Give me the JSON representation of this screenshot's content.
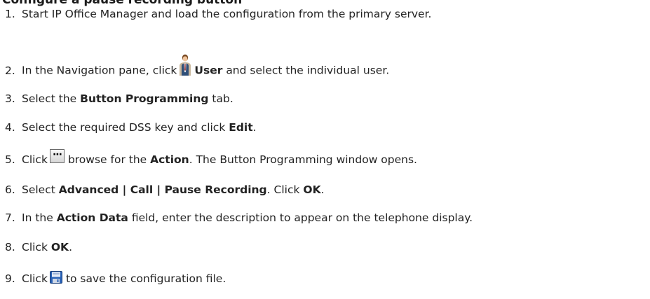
{
  "heading": "Configure a pause recording button",
  "steps": [
    {
      "num": "1.",
      "text": "Start IP Office Manager and load the configuration from the primary server."
    },
    {
      "num": "2.",
      "pre": "In the Navigation pane, click",
      "bold": "User",
      "post": "and select the individual user.",
      "icon": "user-icon"
    },
    {
      "num": "3.",
      "pre": "Select the",
      "bold": "Button Programming",
      "post": "tab."
    },
    {
      "num": "4.",
      "pre": "Select the required DSS key and click",
      "bold": "Edit",
      "post": "."
    },
    {
      "num": "5.",
      "pre": "Click",
      "mid": "browse for the",
      "bold": "Action",
      "post": ". The Button Programming window opens.",
      "icon": "browse-button-icon"
    },
    {
      "num": "6.",
      "pre": "Select",
      "bold": "Advanced | Call | Pause Recording",
      "mid": ". Click",
      "bold2": "OK",
      "post": "."
    },
    {
      "num": "7.",
      "pre": "In the",
      "bold": "Action Data",
      "post": "field, enter the description to appear on the telephone display."
    },
    {
      "num": "8.",
      "pre": "Click",
      "bold": "OK",
      "post": "."
    },
    {
      "num": "9.",
      "pre": "Click",
      "post": "to save the configuration file.",
      "icon": "save-icon"
    }
  ]
}
